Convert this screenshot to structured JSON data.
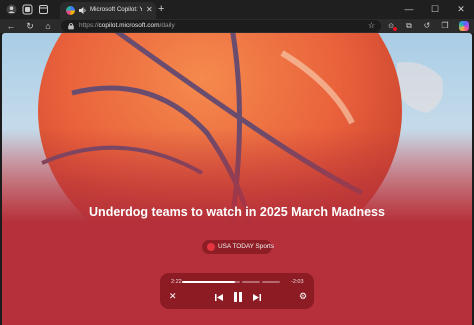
{
  "browser": {
    "tab": {
      "title": "Microsoft Copilot: Your AI co"
    },
    "address": {
      "protocol": "https://",
      "host": "copilot.microsoft.com",
      "path": "/daily"
    }
  },
  "icons": {
    "profile": "profile-icon",
    "workspaces": "workspaces-icon",
    "tab_actions": "tab-actions-icon",
    "audio": "speaker-icon",
    "close_tab": "close-icon",
    "new_tab": "plus-icon",
    "back": "back-arrow-icon",
    "refresh": "refresh-icon",
    "home": "home-icon",
    "site_info": "lock-icon",
    "favorite": "star-icon",
    "history": "history-icon",
    "collections": "collections-icon",
    "copilot": "copilot-icon"
  },
  "article": {
    "headline": "Underdog teams to watch in 2025 March Madness",
    "source": "USA TODAY Sports"
  },
  "player": {
    "elapsed": "2:22",
    "remaining": "-2:03",
    "progress": 0.54
  },
  "colors": {
    "page_background": "#b5303a",
    "player_background": "#8c1b24",
    "source_pill": "#8e1d26",
    "ball_orange": "#e9613b",
    "sky_blue": "#a9cde6"
  }
}
